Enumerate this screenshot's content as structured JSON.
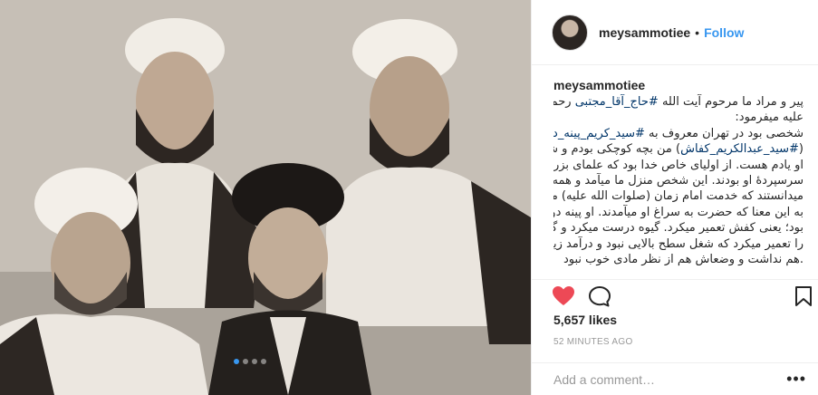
{
  "post": {
    "image_alt": "black and white photo of four clerics",
    "carousel": {
      "count": 4,
      "active_index": 0
    }
  },
  "header": {
    "username": "meysammotiee",
    "separator": "•",
    "follow_label": "Follow"
  },
  "caption": {
    "username": "meysammotiee",
    "lines": [
      "پیر و مراد ما مرحوم آیت الله #حاج_آقا_مجتبی رحمة الله",
      "علیه میفرمود:",
      "شخصی بود در تهران معروف به #سید_کریم_پینه_دوز»",
      "(#سید_عبدالکریم_کفاش) من بچه کوچکی بودم و شبحی از",
      "او یادم هست. از اولیای خاص خدا بود که علمای بزرگ",
      "سرسپردهٔ او بودند. این شخص منزل ما میآمد و همه",
      "میدانستند که خدمت امام زمان (صلوات الله علیه) میرسد.",
      "به این معنا که حضرت به سراغ او میآمدند. او پینه دوز",
      "بود؛ یعنی کفش تعمیر میکرد. گیوه درست میکرد و گیوهها",
      "را تعمیر میکرد که شغل سطح بالایی نبود و درآمد زیادی",
      ".هم نداشت و وضعاش هم از نظر مادی خوب نبود"
    ]
  },
  "actions": {
    "like_icon": "heart-filled-icon",
    "comment_icon": "comment-icon",
    "save_icon": "bookmark-icon",
    "like_color": "#ed4956"
  },
  "stats": {
    "likes": "5,657 likes",
    "time": "52 MINUTES AGO"
  },
  "comment": {
    "placeholder": "Add a comment…",
    "more_label": "•••"
  },
  "colors": {
    "link": "#3897f0",
    "hashtag": "#003569",
    "muted": "#999999",
    "text": "#262626"
  }
}
